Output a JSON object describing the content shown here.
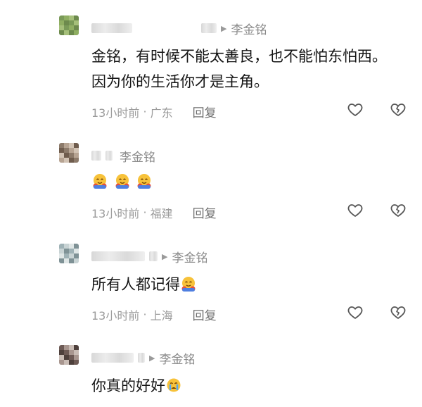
{
  "comments": [
    {
      "reply_to": "李金铭",
      "text": "金铭，有时候不能太善良，也不能怕东怕西。因为你的生活你才是主角。",
      "time": "13小时前",
      "location": "广东",
      "reply_label": "回复",
      "avatar_colors": [
        "#7a9a58",
        "#8fae62",
        "#6d8a4d",
        "#a5bf7a"
      ]
    },
    {
      "reply_to": "李金铭",
      "text": "",
      "emoji": [
        "hugging-face-emoji",
        "hugging-face-emoji",
        "hugging-face-emoji"
      ],
      "time": "13小时前",
      "location": "福建",
      "reply_label": "回复",
      "avatar_colors": [
        "#8c7a6a",
        "#b7a493",
        "#6f5c4d",
        "#d2c3b4"
      ]
    },
    {
      "reply_to": "李金铭",
      "text": "所有人都记得",
      "emoji": [
        "hugging-face-emoji"
      ],
      "time": "13小时前",
      "location": "上海",
      "reply_label": "回复",
      "avatar_colors": [
        "#9fb2b6",
        "#c8d3d4",
        "#7f9296",
        "#dfe6e6"
      ]
    },
    {
      "reply_to": "李金铭",
      "text": "你真的好好",
      "emoji": [
        "crying-face-emoji"
      ],
      "avatar_colors": [
        "#6d5a55",
        "#a8968f",
        "#4e403c",
        "#c9bcb5"
      ]
    }
  ],
  "colors": {
    "meta": "#9b9b9b",
    "text": "#151515",
    "icon": "#666666"
  }
}
